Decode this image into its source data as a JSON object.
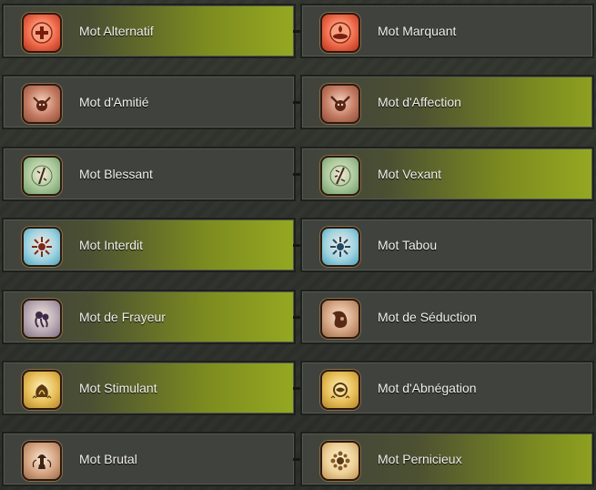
{
  "rows": [
    {
      "left": {
        "label": "Mot Alternatif",
        "icon": "alternatif-icon",
        "color": "#e85a3c"
      },
      "right": {
        "label": "Mot Marquant",
        "icon": "marquant-icon",
        "color": "#e85a3c"
      }
    },
    {
      "left": {
        "label": "Mot d'Amitié",
        "icon": "amitie-icon",
        "color": "#b86b55"
      },
      "right": {
        "label": "Mot d'Affection",
        "icon": "affection-icon",
        "color": "#b86b55"
      }
    },
    {
      "left": {
        "label": "Mot Blessant",
        "icon": "blessant-icon",
        "color": "#8fb981"
      },
      "right": {
        "label": "Mot Vexant",
        "icon": "vexant-icon",
        "color": "#8fb981"
      }
    },
    {
      "left": {
        "label": "Mot Interdit",
        "icon": "interdit-icon",
        "color": "#5fb1c7"
      },
      "right": {
        "label": "Mot Tabou",
        "icon": "tabou-icon",
        "color": "#5fb1c7"
      }
    },
    {
      "left": {
        "label": "Mot de Frayeur",
        "icon": "frayeur-icon",
        "color": "#9c8b9c"
      },
      "right": {
        "label": "Mot de Séduction",
        "icon": "seduction-icon",
        "color": "#b07a5c"
      }
    },
    {
      "left": {
        "label": "Mot Stimulant",
        "icon": "stimulant-icon",
        "color": "#d8a93e"
      },
      "right": {
        "label": "Mot d'Abnégation",
        "icon": "abnegation-icon",
        "color": "#d8a93e"
      }
    },
    {
      "left": {
        "label": "Mot Brutal",
        "icon": "brutal-icon",
        "color": "#c4906a"
      },
      "right": {
        "label": "Mot Pernicieux",
        "icon": "pernicieux-icon",
        "color": "#e0bd7e"
      }
    }
  ],
  "colors": {
    "highlight": "#95a821",
    "panel": "#40423d",
    "text": "#f1f1ec"
  }
}
